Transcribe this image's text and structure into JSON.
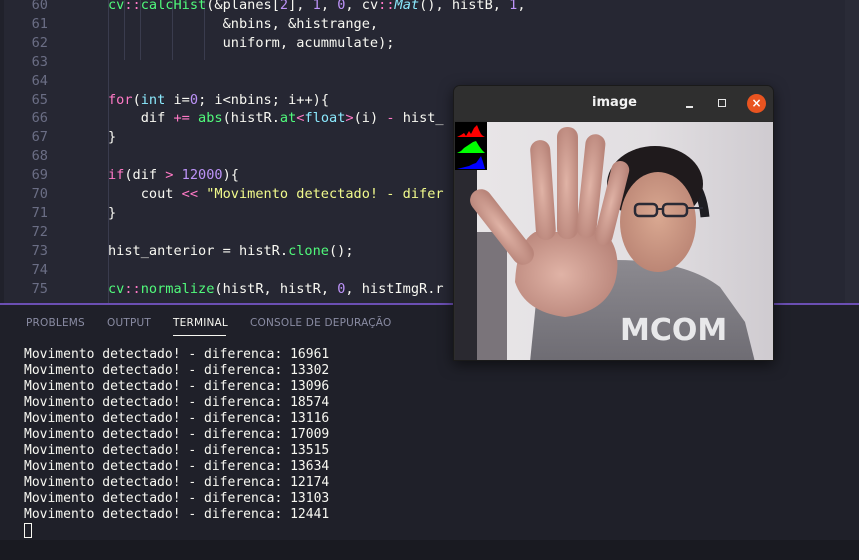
{
  "editor": {
    "lines": [
      {
        "n": "60",
        "tokens": [
          [
            "fn",
            "cv"
          ],
          [
            "op",
            "::"
          ],
          [
            "fn",
            "calcHist"
          ],
          [
            "plain",
            "(&planes["
          ],
          [
            "num",
            "2"
          ],
          [
            "plain",
            "], "
          ],
          [
            "num",
            "1"
          ],
          [
            "plain",
            ", "
          ],
          [
            "num",
            "0"
          ],
          [
            "plain",
            ", cv"
          ],
          [
            "op",
            "::"
          ],
          [
            "it",
            "Mat"
          ],
          [
            "plain",
            "(), histB, "
          ],
          [
            "num",
            "1"
          ],
          [
            "plain",
            ","
          ]
        ]
      },
      {
        "n": "61",
        "tokens": [
          [
            "plain",
            "              &nbins, &histrange,"
          ]
        ]
      },
      {
        "n": "62",
        "tokens": [
          [
            "plain",
            "              uniform, acummulate);"
          ]
        ]
      },
      {
        "n": "63",
        "tokens": []
      },
      {
        "n": "64",
        "tokens": []
      },
      {
        "n": "65",
        "tokens": [
          [
            "kw",
            "for"
          ],
          [
            "plain",
            "("
          ],
          [
            "ty",
            "int"
          ],
          [
            "plain",
            " i="
          ],
          [
            "num",
            "0"
          ],
          [
            "plain",
            "; i<nbins; i++){"
          ]
        ]
      },
      {
        "n": "66",
        "tokens": [
          [
            "plain",
            "    dif "
          ],
          [
            "op",
            "+="
          ],
          [
            "plain",
            " "
          ],
          [
            "fn",
            "abs"
          ],
          [
            "plain",
            "(histR."
          ],
          [
            "fn",
            "at"
          ],
          [
            "op",
            "<"
          ],
          [
            "ty",
            "float"
          ],
          [
            "op",
            ">"
          ],
          [
            "plain",
            "(i) "
          ],
          [
            "op",
            "-"
          ],
          [
            "plain",
            " hist_"
          ]
        ]
      },
      {
        "n": "67",
        "tokens": [
          [
            "plain",
            "}"
          ]
        ]
      },
      {
        "n": "68",
        "tokens": []
      },
      {
        "n": "69",
        "tokens": [
          [
            "kw",
            "if"
          ],
          [
            "plain",
            "(dif "
          ],
          [
            "op",
            ">"
          ],
          [
            "plain",
            " "
          ],
          [
            "num",
            "12000"
          ],
          [
            "plain",
            "){"
          ]
        ]
      },
      {
        "n": "70",
        "tokens": [
          [
            "plain",
            "    cout "
          ],
          [
            "op",
            "<<"
          ],
          [
            "plain",
            " "
          ],
          [
            "str",
            "\"Movimento detectado! - difer"
          ]
        ]
      },
      {
        "n": "71",
        "tokens": [
          [
            "plain",
            "}"
          ]
        ]
      },
      {
        "n": "72",
        "tokens": []
      },
      {
        "n": "73",
        "tokens": [
          [
            "plain",
            "hist_anterior = histR."
          ],
          [
            "fn",
            "clone"
          ],
          [
            "plain",
            "();"
          ]
        ]
      },
      {
        "n": "74",
        "tokens": []
      },
      {
        "n": "75",
        "tokens": [
          [
            "fn",
            "cv"
          ],
          [
            "op",
            "::"
          ],
          [
            "fn",
            "normalize"
          ],
          [
            "plain",
            "(histR, histR, "
          ],
          [
            "num",
            "0"
          ],
          [
            "plain",
            ", histImgR.r"
          ]
        ]
      }
    ]
  },
  "panel": {
    "tabs": [
      "PROBLEMS",
      "OUTPUT",
      "TERMINAL",
      "CONSOLE DE DEPURAÇÃO"
    ],
    "active_tab": "TERMINAL",
    "terminal_lines": [
      "Movimento detectado! - diferenca: 16961",
      "Movimento detectado! - diferenca: 13302",
      "Movimento detectado! - diferenca: 13096",
      "Movimento detectado! - diferenca: 18574",
      "Movimento detectado! - diferenca: 13116",
      "Movimento detectado! - diferenca: 17009",
      "Movimento detectado! - diferenca: 13515",
      "Movimento detectado! - diferenca: 13634",
      "Movimento detectado! - diferenca: 12174",
      "Movimento detectado! - diferenca: 13103",
      "Movimento detectado! - diferenca: 12441"
    ]
  },
  "image_window": {
    "title": "image",
    "minimize_icon": "minimize-icon",
    "maximize_icon": "maximize-icon",
    "close_icon": "close-icon",
    "close_symbol": "×",
    "hist_colors": [
      "#ff0000",
      "#00ff00",
      "#0000ff"
    ]
  },
  "colors": {
    "panel_accent": "#6b4fb3",
    "close_button": "#e95420"
  }
}
